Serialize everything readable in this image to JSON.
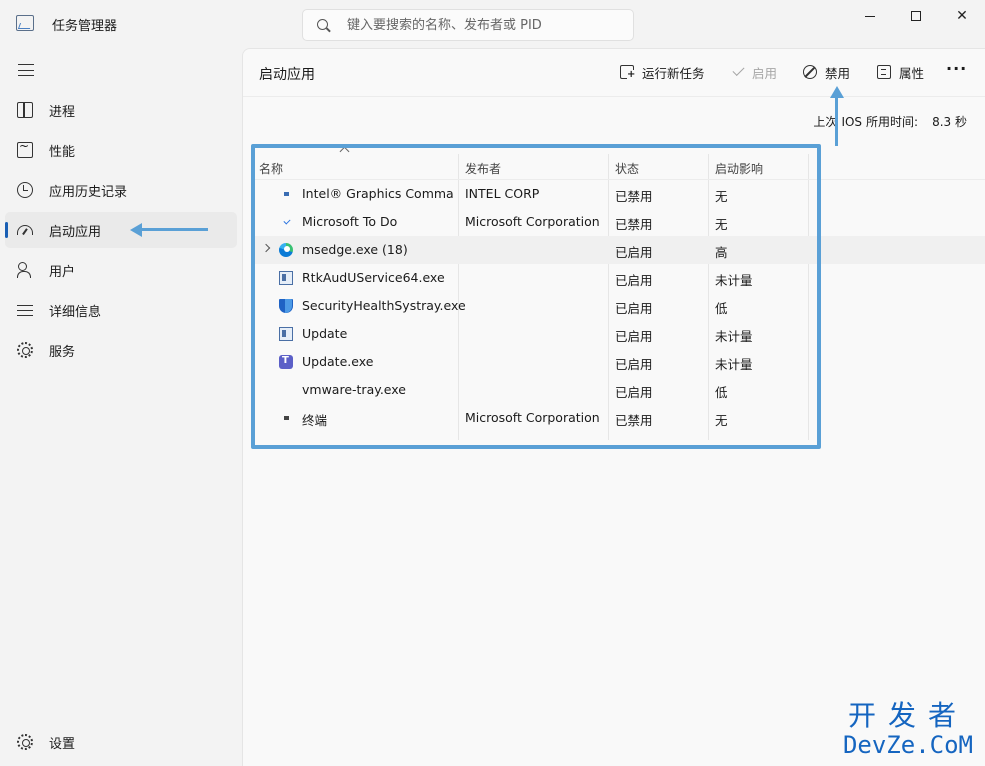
{
  "window": {
    "title": "任务管理器",
    "search_placeholder": "键入要搜索的名称、发布者或 PID",
    "minimize_icon": "minimize-icon",
    "maximize_icon": "maximize-icon",
    "close_glyph": "✕"
  },
  "sidebar": {
    "items": [
      {
        "label": "进程",
        "icon": "processes-icon"
      },
      {
        "label": "性能",
        "icon": "performance-icon"
      },
      {
        "label": "应用历史记录",
        "icon": "app-history-icon"
      },
      {
        "label": "启动应用",
        "icon": "startup-icon",
        "active": true
      },
      {
        "label": "用户",
        "icon": "users-icon"
      },
      {
        "label": "详细信息",
        "icon": "details-icon"
      },
      {
        "label": "服务",
        "icon": "services-icon"
      }
    ],
    "settings_label": "设置"
  },
  "main": {
    "title": "启动应用",
    "toolbar": {
      "run_new_task": "运行新任务",
      "enable": "启用",
      "disable": "禁用",
      "properties": "属性",
      "more": "···"
    },
    "bios": {
      "label_prefix": "上次",
      "label_mid": "IOS",
      "label_suffix": "所用时间:",
      "value": "8.3 秒"
    },
    "columns": [
      "名称",
      "发布者",
      "状态",
      "启动影响"
    ],
    "rows": [
      {
        "name": "Intel® Graphics Comma...",
        "publisher": "INTEL CORP",
        "status": "已禁用",
        "impact": "无",
        "icon": "intel-icon"
      },
      {
        "name": "Microsoft To Do",
        "publisher": "Microsoft Corporation",
        "status": "已禁用",
        "impact": "无",
        "icon": "todo-icon"
      },
      {
        "name": "msedge.exe (18)",
        "publisher": "",
        "status": "已启用",
        "impact": "高",
        "icon": "edge-icon",
        "expandable": true
      },
      {
        "name": "RtkAudUService64.exe",
        "publisher": "",
        "status": "已启用",
        "impact": "未计量",
        "icon": "app-window-icon"
      },
      {
        "name": "SecurityHealthSystray.exe",
        "publisher": "",
        "status": "已启用",
        "impact": "低",
        "icon": "shield-icon"
      },
      {
        "name": "Update",
        "publisher": "",
        "status": "已启用",
        "impact": "未计量",
        "icon": "app-window-icon"
      },
      {
        "name": "Update.exe",
        "publisher": "",
        "status": "已启用",
        "impact": "未计量",
        "icon": "teams-icon"
      },
      {
        "name": "vmware-tray.exe",
        "publisher": "",
        "status": "已启用",
        "impact": "低",
        "icon": ""
      },
      {
        "name": "终端",
        "publisher": "Microsoft Corporation",
        "status": "已禁用",
        "impact": "无",
        "icon": "terminal-icon"
      }
    ]
  },
  "watermark": {
    "cn": "开发者",
    "en": "DevZe.CoM"
  },
  "colors": {
    "accent": "#1a5fb4",
    "annotation": "#5aa0d6",
    "watermark": "#1565c0"
  }
}
